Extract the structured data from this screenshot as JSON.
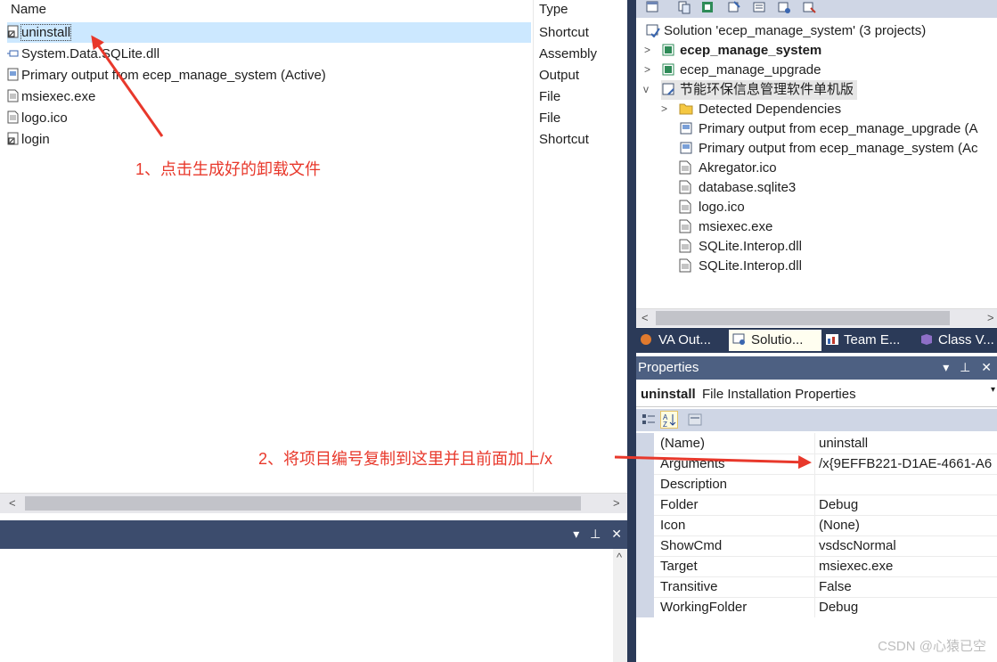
{
  "file_list": {
    "col_name": "Name",
    "col_type": "Type",
    "rows": [
      {
        "name": "uninstall",
        "type": "Shortcut",
        "icon": "shortcut-icon",
        "selected": true
      },
      {
        "name": "System.Data.SQLite.dll",
        "type": "Assembly",
        "icon": "assembly-icon",
        "selected": false
      },
      {
        "name": "Primary output from ecep_manage_system (Active)",
        "type": "Output",
        "icon": "output-icon",
        "selected": false
      },
      {
        "name": "msiexec.exe",
        "type": "File",
        "icon": "file-icon",
        "selected": false
      },
      {
        "name": "logo.ico",
        "type": "File",
        "icon": "file-icon",
        "selected": false
      },
      {
        "name": "login",
        "type": "Shortcut",
        "icon": "shortcut-icon",
        "selected": false
      }
    ],
    "scroll_left": "<",
    "scroll_right": ">"
  },
  "bottom_panel": {
    "pin": "▾ ⊥ ✕",
    "scroll_up": "^"
  },
  "solution_explorer": {
    "items": [
      {
        "label": "Solution 'ecep_manage_system' (3 projects)",
        "expander": "",
        "bold": false
      },
      {
        "label": "ecep_manage_system",
        "expander": ">",
        "bold": true
      },
      {
        "label": "ecep_manage_upgrade",
        "expander": ">",
        "bold": false
      },
      {
        "label": "节能环保信息管理软件单机版",
        "expander": "v",
        "bold": false
      },
      {
        "label": "Detected Dependencies",
        "expander": ">",
        "bold": false
      },
      {
        "label": "Primary output from ecep_manage_upgrade (A",
        "expander": "",
        "bold": false
      },
      {
        "label": "Primary output from ecep_manage_system (Ac",
        "expander": "",
        "bold": false
      },
      {
        "label": "Akregator.ico",
        "expander": "",
        "bold": false
      },
      {
        "label": "database.sqlite3",
        "expander": "",
        "bold": false
      },
      {
        "label": "logo.ico",
        "expander": "",
        "bold": false
      },
      {
        "label": "msiexec.exe",
        "expander": "",
        "bold": false
      },
      {
        "label": "SQLite.Interop.dll",
        "expander": "",
        "bold": false
      },
      {
        "label": "SQLite.Interop.dll",
        "expander": "",
        "bold": false
      }
    ],
    "scroll_left": "<",
    "scroll_right": ">"
  },
  "tabs": [
    {
      "label": "VA Out...",
      "active": false
    },
    {
      "label": "Solutio...",
      "active": true
    },
    {
      "label": "Team E...",
      "active": false
    },
    {
      "label": "Class V...",
      "active": false
    }
  ],
  "properties": {
    "title": "Properties",
    "header_buttons": "▾ ⊥ ✕",
    "object_name": "uninstall",
    "object_type": "File Installation Properties",
    "rows": [
      {
        "name": "(Name)",
        "value": "uninstall"
      },
      {
        "name": "Arguments",
        "value": "/x{9EFFB221-D1AE-4661-A6"
      },
      {
        "name": "Description",
        "value": ""
      },
      {
        "name": "Folder",
        "value": "Debug"
      },
      {
        "name": "Icon",
        "value": "(None)"
      },
      {
        "name": "ShowCmd",
        "value": "vsdscNormal"
      },
      {
        "name": "Target",
        "value": "msiexec.exe"
      },
      {
        "name": "Transitive",
        "value": "False"
      },
      {
        "name": "WorkingFolder",
        "value": "Debug"
      }
    ]
  },
  "annotations": {
    "step1": "1、点击生成好的卸载文件",
    "step2": "2、将项目编号复制到这里并且前面加上/x",
    "color": "#e8382b"
  },
  "watermark": "CSDN @心猿已空"
}
